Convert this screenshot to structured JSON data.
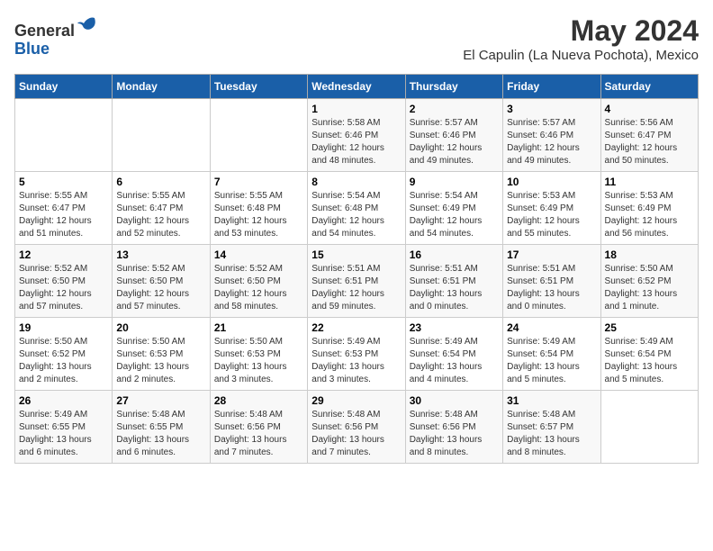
{
  "header": {
    "logo_line1": "General",
    "logo_line2": "Blue",
    "main_title": "May 2024",
    "subtitle": "El Capulin (La Nueva Pochota), Mexico"
  },
  "days_of_week": [
    "Sunday",
    "Monday",
    "Tuesday",
    "Wednesday",
    "Thursday",
    "Friday",
    "Saturday"
  ],
  "weeks": [
    [
      {
        "day": "",
        "info": ""
      },
      {
        "day": "",
        "info": ""
      },
      {
        "day": "",
        "info": ""
      },
      {
        "day": "1",
        "info": "Sunrise: 5:58 AM\nSunset: 6:46 PM\nDaylight: 12 hours\nand 48 minutes."
      },
      {
        "day": "2",
        "info": "Sunrise: 5:57 AM\nSunset: 6:46 PM\nDaylight: 12 hours\nand 49 minutes."
      },
      {
        "day": "3",
        "info": "Sunrise: 5:57 AM\nSunset: 6:46 PM\nDaylight: 12 hours\nand 49 minutes."
      },
      {
        "day": "4",
        "info": "Sunrise: 5:56 AM\nSunset: 6:47 PM\nDaylight: 12 hours\nand 50 minutes."
      }
    ],
    [
      {
        "day": "5",
        "info": "Sunrise: 5:55 AM\nSunset: 6:47 PM\nDaylight: 12 hours\nand 51 minutes."
      },
      {
        "day": "6",
        "info": "Sunrise: 5:55 AM\nSunset: 6:47 PM\nDaylight: 12 hours\nand 52 minutes."
      },
      {
        "day": "7",
        "info": "Sunrise: 5:55 AM\nSunset: 6:48 PM\nDaylight: 12 hours\nand 53 minutes."
      },
      {
        "day": "8",
        "info": "Sunrise: 5:54 AM\nSunset: 6:48 PM\nDaylight: 12 hours\nand 54 minutes."
      },
      {
        "day": "9",
        "info": "Sunrise: 5:54 AM\nSunset: 6:49 PM\nDaylight: 12 hours\nand 54 minutes."
      },
      {
        "day": "10",
        "info": "Sunrise: 5:53 AM\nSunset: 6:49 PM\nDaylight: 12 hours\nand 55 minutes."
      },
      {
        "day": "11",
        "info": "Sunrise: 5:53 AM\nSunset: 6:49 PM\nDaylight: 12 hours\nand 56 minutes."
      }
    ],
    [
      {
        "day": "12",
        "info": "Sunrise: 5:52 AM\nSunset: 6:50 PM\nDaylight: 12 hours\nand 57 minutes."
      },
      {
        "day": "13",
        "info": "Sunrise: 5:52 AM\nSunset: 6:50 PM\nDaylight: 12 hours\nand 57 minutes."
      },
      {
        "day": "14",
        "info": "Sunrise: 5:52 AM\nSunset: 6:50 PM\nDaylight: 12 hours\nand 58 minutes."
      },
      {
        "day": "15",
        "info": "Sunrise: 5:51 AM\nSunset: 6:51 PM\nDaylight: 12 hours\nand 59 minutes."
      },
      {
        "day": "16",
        "info": "Sunrise: 5:51 AM\nSunset: 6:51 PM\nDaylight: 13 hours\nand 0 minutes."
      },
      {
        "day": "17",
        "info": "Sunrise: 5:51 AM\nSunset: 6:51 PM\nDaylight: 13 hours\nand 0 minutes."
      },
      {
        "day": "18",
        "info": "Sunrise: 5:50 AM\nSunset: 6:52 PM\nDaylight: 13 hours\nand 1 minute."
      }
    ],
    [
      {
        "day": "19",
        "info": "Sunrise: 5:50 AM\nSunset: 6:52 PM\nDaylight: 13 hours\nand 2 minutes."
      },
      {
        "day": "20",
        "info": "Sunrise: 5:50 AM\nSunset: 6:53 PM\nDaylight: 13 hours\nand 2 minutes."
      },
      {
        "day": "21",
        "info": "Sunrise: 5:50 AM\nSunset: 6:53 PM\nDaylight: 13 hours\nand 3 minutes."
      },
      {
        "day": "22",
        "info": "Sunrise: 5:49 AM\nSunset: 6:53 PM\nDaylight: 13 hours\nand 3 minutes."
      },
      {
        "day": "23",
        "info": "Sunrise: 5:49 AM\nSunset: 6:54 PM\nDaylight: 13 hours\nand 4 minutes."
      },
      {
        "day": "24",
        "info": "Sunrise: 5:49 AM\nSunset: 6:54 PM\nDaylight: 13 hours\nand 5 minutes."
      },
      {
        "day": "25",
        "info": "Sunrise: 5:49 AM\nSunset: 6:54 PM\nDaylight: 13 hours\nand 5 minutes."
      }
    ],
    [
      {
        "day": "26",
        "info": "Sunrise: 5:49 AM\nSunset: 6:55 PM\nDaylight: 13 hours\nand 6 minutes."
      },
      {
        "day": "27",
        "info": "Sunrise: 5:48 AM\nSunset: 6:55 PM\nDaylight: 13 hours\nand 6 minutes."
      },
      {
        "day": "28",
        "info": "Sunrise: 5:48 AM\nSunset: 6:56 PM\nDaylight: 13 hours\nand 7 minutes."
      },
      {
        "day": "29",
        "info": "Sunrise: 5:48 AM\nSunset: 6:56 PM\nDaylight: 13 hours\nand 7 minutes."
      },
      {
        "day": "30",
        "info": "Sunrise: 5:48 AM\nSunset: 6:56 PM\nDaylight: 13 hours\nand 8 minutes."
      },
      {
        "day": "31",
        "info": "Sunrise: 5:48 AM\nSunset: 6:57 PM\nDaylight: 13 hours\nand 8 minutes."
      },
      {
        "day": "",
        "info": ""
      }
    ]
  ]
}
